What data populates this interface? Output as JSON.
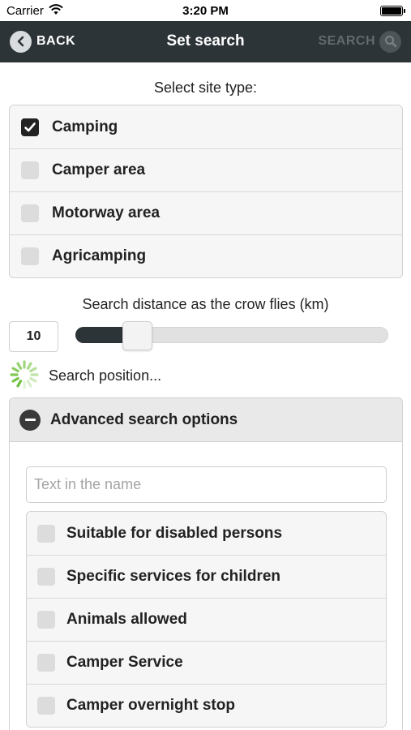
{
  "status_bar": {
    "carrier": "Carrier",
    "time": "3:20 PM"
  },
  "navbar": {
    "back_label": "BACK",
    "title": "Set search",
    "search_label": "SEARCH",
    "bar_color": "#2d3438"
  },
  "site_type": {
    "caption": "Select site type:",
    "options": [
      {
        "label": "Camping",
        "checked": true
      },
      {
        "label": "Camper area",
        "checked": false
      },
      {
        "label": "Motorway area",
        "checked": false
      },
      {
        "label": "Agricamping",
        "checked": false
      }
    ]
  },
  "distance": {
    "caption": "Search distance as the crow flies (km)",
    "value": "10",
    "slider_fraction": 0.18
  },
  "position": {
    "status_text": "Search position..."
  },
  "advanced": {
    "title": "Advanced search options",
    "name_placeholder": "Text in the name",
    "name_value": "",
    "options": [
      {
        "label": "Suitable for disabled persons",
        "checked": false
      },
      {
        "label": "Specific services for children",
        "checked": false
      },
      {
        "label": "Animals allowed",
        "checked": false
      },
      {
        "label": "Camper Service",
        "checked": false
      },
      {
        "label": "Camper overnight stop",
        "checked": false
      }
    ]
  }
}
